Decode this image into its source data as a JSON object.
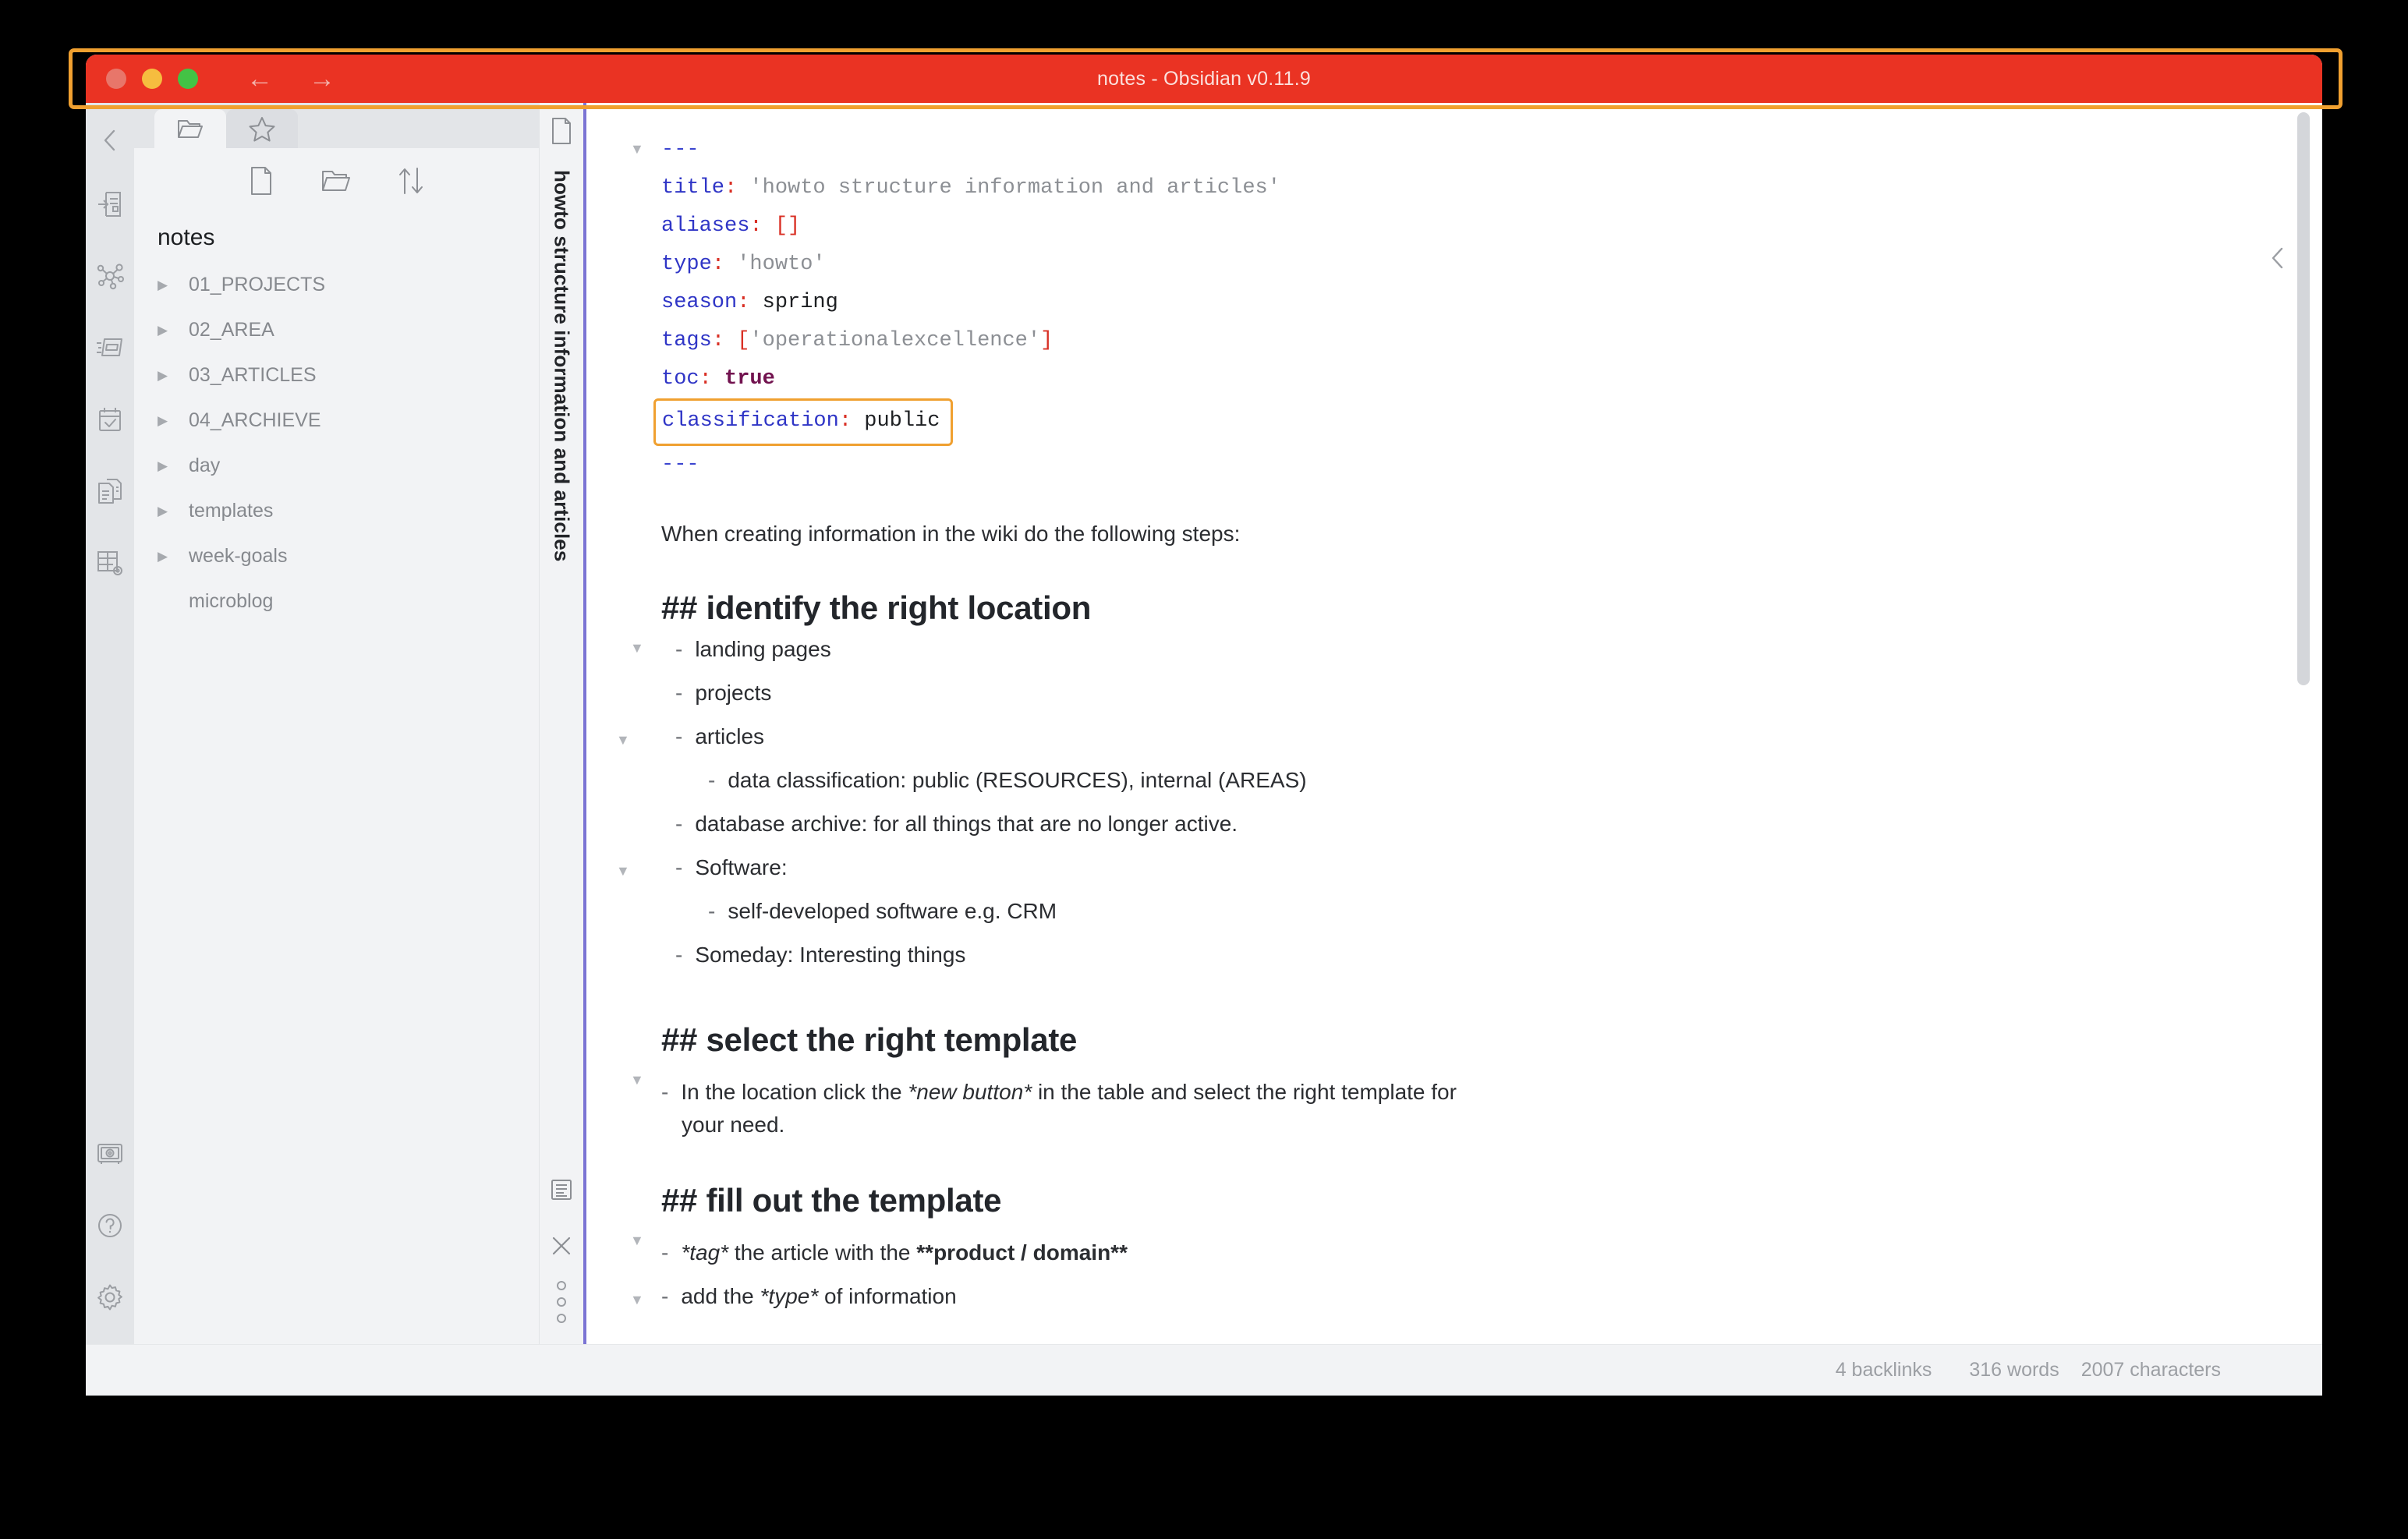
{
  "window": {
    "title": "notes - Obsidian v0.11.9",
    "traffic_lights": [
      "close",
      "minimize",
      "maximize"
    ],
    "nav_back": "←",
    "nav_forward": "→",
    "accent_color": "#7b74d4",
    "titlebar_color": "#ea3323",
    "annotation_color": "#f0a030"
  },
  "ribbon": {
    "collapse_icon": "‹",
    "items": [
      {
        "name": "open-quick-switcher",
        "icon": "quick-switcher-icon"
      },
      {
        "name": "open-graph-view",
        "icon": "graph-icon"
      },
      {
        "name": "open-card-board",
        "icon": "cards-icon"
      },
      {
        "name": "open-calendar",
        "icon": "calendar-check-icon"
      },
      {
        "name": "open-templates",
        "icon": "copy-pages-icon"
      },
      {
        "name": "open-table-settings",
        "icon": "table-gear-icon"
      }
    ],
    "bottom_items": [
      {
        "name": "open-vault",
        "icon": "vault-icon"
      },
      {
        "name": "open-help",
        "icon": "help-circle-icon"
      },
      {
        "name": "open-settings",
        "icon": "gear-icon"
      }
    ]
  },
  "explorer": {
    "tabs": [
      {
        "name": "files-tab",
        "icon": "folder-icon",
        "active": true
      },
      {
        "name": "starred-tab",
        "icon": "star-icon",
        "active": false
      }
    ],
    "toolbar": [
      {
        "name": "new-note-button",
        "icon": "new-note-icon"
      },
      {
        "name": "new-folder-button",
        "icon": "new-folder-icon"
      },
      {
        "name": "change-sort-order-button",
        "icon": "sort-icon"
      }
    ],
    "vault_name": "notes",
    "tree": [
      {
        "label": "01_PROJECTS",
        "type": "folder",
        "expanded": false
      },
      {
        "label": "02_AREA",
        "type": "folder",
        "expanded": false
      },
      {
        "label": "03_ARTICLES",
        "type": "folder",
        "expanded": false
      },
      {
        "label": "04_ARCHIEVE",
        "type": "folder",
        "expanded": false
      },
      {
        "label": "day",
        "type": "folder",
        "expanded": false
      },
      {
        "label": "templates",
        "type": "folder",
        "expanded": false
      },
      {
        "label": "week-goals",
        "type": "folder",
        "expanded": false
      },
      {
        "label": "microblog",
        "type": "file",
        "expanded": false
      }
    ],
    "arrow_glyph": "▶"
  },
  "vtabs": {
    "file_icon": "document-icon",
    "title": "howto structure information and articles",
    "bottom_items": [
      {
        "name": "toggle-reading-view",
        "icon": "reading-view-icon"
      },
      {
        "name": "close-pane-button",
        "icon": "close-icon"
      },
      {
        "name": "more-options-button",
        "icon": "vertical-dots-icon"
      }
    ]
  },
  "editor": {
    "fold_glyph": "▼",
    "right_collapse_icon": "‹",
    "frontmatter": {
      "open_delim": "---",
      "close_delim": "---",
      "fields": [
        {
          "key": "title",
          "value": "'howto structure information and articles'",
          "kind": "string"
        },
        {
          "key": "aliases",
          "value": "[]",
          "kind": "bracket"
        },
        {
          "key": "type",
          "value": "'howto'",
          "kind": "string"
        },
        {
          "key": "season",
          "value": "spring",
          "kind": "plain"
        },
        {
          "key": "tags",
          "value": "['operationalexcellence']",
          "kind": "taglist"
        },
        {
          "key": "toc",
          "value": "true",
          "kind": "bool"
        },
        {
          "key": "classification",
          "value": "public",
          "kind": "plain",
          "highlighted": true
        }
      ]
    },
    "intro": "When creating information in the wiki do the following steps:",
    "sections": [
      {
        "heading": "## identify the right location",
        "items": [
          {
            "text": "landing pages",
            "level": 1,
            "fold": false
          },
          {
            "text": "projects",
            "level": 1,
            "fold": false
          },
          {
            "text": "articles",
            "level": 1,
            "fold": true
          },
          {
            "text": "data classification: public (RESOURCES), internal (AREAS)",
            "level": 2,
            "fold": false
          },
          {
            "text": "database archive: for all things that are no longer active.",
            "level": 1,
            "fold": false
          },
          {
            "text": "Software:",
            "level": 1,
            "fold": true
          },
          {
            "text": "self-developed software e.g. CRM",
            "level": 2,
            "fold": false
          },
          {
            "text": "Someday: Interesting things",
            "level": 1,
            "fold": false
          }
        ]
      },
      {
        "heading": "## select the right template",
        "paragraph_parts": [
          {
            "t": "In the location click the ",
            "style": "normal"
          },
          {
            "t": "*new button*",
            "style": "italic"
          },
          {
            "t": " in the table and select the right template for",
            "style": "normal"
          }
        ],
        "paragraph_wrap": "your need."
      },
      {
        "heading": "## fill out the template",
        "tag_line_parts": [
          {
            "t": "*tag*",
            "style": "italic"
          },
          {
            "t": " the article with the ",
            "style": "normal"
          },
          {
            "t": "**product / domain**",
            "style": "bold"
          }
        ],
        "last_line_parts": [
          {
            "t": "add the ",
            "style": "normal"
          },
          {
            "t": "*type*",
            "style": "italic"
          },
          {
            "t": " of information",
            "style": "normal"
          }
        ]
      }
    ]
  },
  "statusbar": {
    "backlinks": "4 backlinks",
    "words": "316 words",
    "characters": "2007 characters"
  }
}
